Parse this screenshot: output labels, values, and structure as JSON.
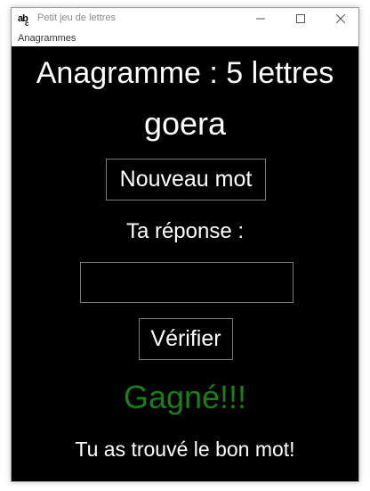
{
  "window": {
    "title": "Petit jeu de lettres",
    "icon": "abc-icon",
    "icon_main": "ab",
    "icon_sub": "c"
  },
  "menubar": {
    "items": [
      "Anagrammes"
    ]
  },
  "game": {
    "heading": "Anagramme : 5 lettres",
    "scrambled_word": "goera",
    "new_word_button": "Nouveau mot",
    "answer_label": "Ta réponse :",
    "answer_value": "",
    "verify_button": "Vérifier",
    "result": "Gagné!!!",
    "message": "Tu as trouvé le bon mot!"
  },
  "colors": {
    "background": "#000000",
    "text": "#ffffff",
    "result": "#1a7f1a",
    "border": "#7a7a7a"
  }
}
